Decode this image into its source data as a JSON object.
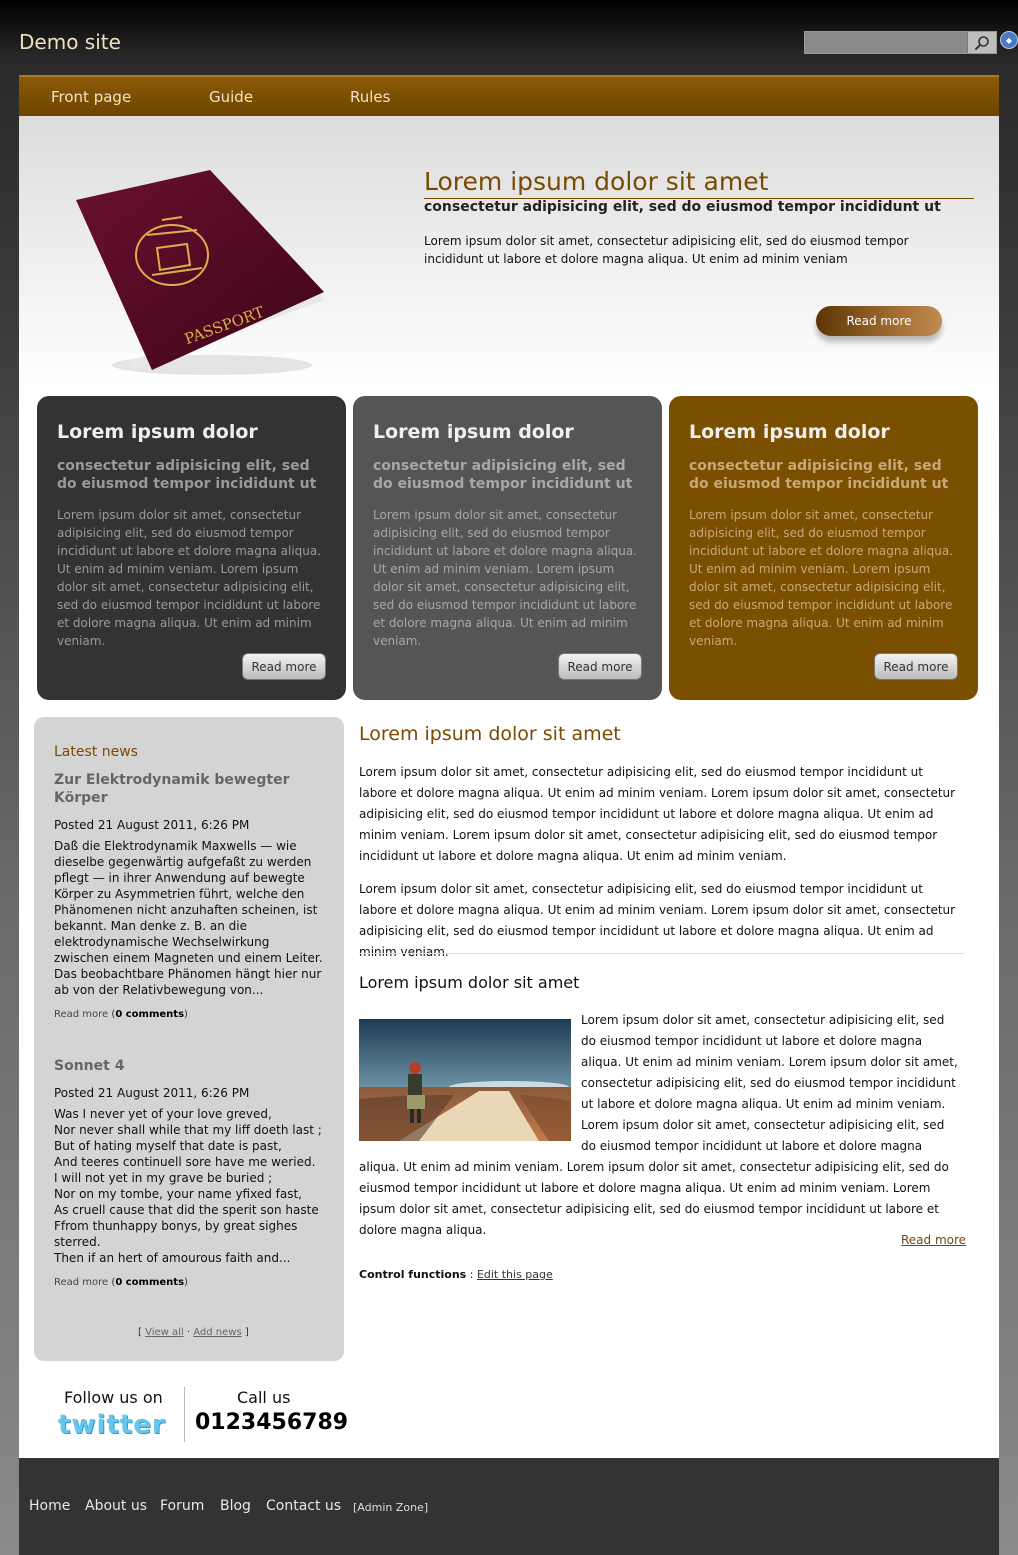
{
  "header": {
    "site_title": "Demo site",
    "search_placeholder": "",
    "search_icon": "magnifier-icon",
    "lang_icon": "language-icon"
  },
  "nav": {
    "items": [
      "Front page",
      "Guide",
      "Rules"
    ]
  },
  "hero": {
    "image": "passport-image",
    "image_text": "PASSPORT",
    "title": "Lorem ipsum dolor sit amet",
    "subtitle": "consectetur adipisicing elit, sed do eiusmod tempor incididunt ut",
    "text": "Lorem ipsum dolor sit amet, consectetur adipisicing elit, sed do eiusmod tempor incididunt ut labore et dolore magna aliqua. Ut enim ad minim veniam",
    "button": "Read more"
  },
  "features": [
    {
      "title": "Lorem ipsum dolor",
      "subtitle": "consectetur adipisicing elit, sed do eiusmod tempor incididunt ut",
      "text": "Lorem ipsum dolor sit amet, consectetur adipisicing elit, sed do eiusmod tempor incididunt ut labore et dolore magna aliqua. Ut enim ad minim veniam. Lorem ipsum dolor sit amet, consectetur adipisicing elit, sed do eiusmod tempor incididunt ut labore et dolore magna aliqua. Ut enim ad minim veniam.",
      "button": "Read more"
    },
    {
      "title": "Lorem ipsum dolor",
      "subtitle": "consectetur adipisicing elit, sed do eiusmod tempor incididunt ut",
      "text": "Lorem ipsum dolor sit amet, consectetur adipisicing elit, sed do eiusmod tempor incididunt ut labore et dolore magna aliqua. Ut enim ad minim veniam. Lorem ipsum dolor sit amet, consectetur adipisicing elit, sed do eiusmod tempor incididunt ut labore et dolore magna aliqua. Ut enim ad minim veniam.",
      "button": "Read more"
    },
    {
      "title": "Lorem ipsum dolor",
      "subtitle": "consectetur adipisicing elit, sed do eiusmod tempor incididunt ut",
      "text": "Lorem ipsum dolor sit amet, consectetur adipisicing elit, sed do eiusmod tempor incididunt ut labore et dolore magna aliqua. Ut enim ad minim veniam. Lorem ipsum dolor sit amet, consectetur adipisicing elit, sed do eiusmod tempor incididunt ut labore et dolore magna aliqua. Ut enim ad minim veniam.",
      "button": "Read more"
    }
  ],
  "news": {
    "title": "Latest news",
    "items": [
      {
        "headline": "Zur Elektrodynamik bewegter Körper",
        "posted": "Posted 21 August 2011, 6:26 PM",
        "body": "Daß die Elektrodynamik Maxwells — wie dieselbe gegenwärtig aufgefaßt zu werden pflegt — in ihrer Anwendung auf bewegte Körper zu Asymmetrien führt, welche den Phänomenen nicht anzuhaften scheinen, ist bekannt. Man denke z. B. an die elektrodynamische Wechselwirkung zwischen einem Magneten und einem Leiter. Das beobachtbare Phänomen hängt hier nur ab von der Relativbewegung von...",
        "read_more": "Read more",
        "comments": "0 comments"
      },
      {
        "headline": "Sonnet 4",
        "posted": "Posted 21 August 2011, 6:26 PM",
        "lines": [
          "Was I never yet of your love greved,",
          "Nor never shall while that my liff doeth last ;",
          "But of hating myself that date is past,",
          "And teeres continuell sore have me weried.",
          "I will not yet in my grave be buried ;",
          "Nor on my tombe, your name yfixed fast,",
          "As cruell cause that did the sperit son haste",
          "Ffrom thunhappy bonys, by great sighes",
          "sterred.",
          "Then if an hert of amourous faith and..."
        ],
        "read_more": "Read more",
        "comments": "0 comments"
      }
    ],
    "view_all": "View all",
    "add_news": "Add news"
  },
  "social": {
    "follow": "Follow us on",
    "twitter": "twitter",
    "call": "Call us",
    "phone": "0123456789"
  },
  "content": {
    "title": "Lorem ipsum dolor sit amet",
    "para1": "Lorem ipsum dolor sit amet, consectetur adipisicing elit, sed do eiusmod tempor incididunt ut labore et dolore magna aliqua. Ut enim ad minim veniam. Lorem ipsum dolor sit amet, consectetur adipisicing elit, sed do eiusmod tempor incididunt ut labore et dolore magna aliqua. Ut enim ad minim veniam. Lorem ipsum dolor sit amet, consectetur adipisicing elit, sed do eiusmod tempor incididunt ut labore et dolore magna aliqua. Ut enim ad minim veniam.",
    "para2": "Lorem ipsum dolor sit amet, consectetur adipisicing elit, sed do eiusmod tempor incididunt ut labore et dolore magna aliqua. Ut enim ad minim veniam. Lorem ipsum dolor sit amet, consectetur adipisicing elit, sed do eiusmod tempor incididunt ut labore et dolore magna aliqua. Ut enim ad minim veniam.",
    "subtitle": "Lorem ipsum dolor sit amet",
    "photo": "road-walker-photo",
    "para3": "Lorem ipsum dolor sit amet, consectetur adipisicing elit, sed do eiusmod tempor incididunt ut labore et dolore magna aliqua. Ut enim ad minim veniam. Lorem ipsum dolor sit amet, consectetur adipisicing elit, sed do eiusmod tempor incididunt ut labore et dolore magna aliqua. Ut enim ad minim veniam. Lorem ipsum dolor sit amet, consectetur adipisicing elit, sed do eiusmod tempor incididunt ut labore et dolore magna aliqua. Ut enim ad minim veniam. Lorem ipsum dolor sit amet, consectetur adipisicing elit, sed do eiusmod tempor incididunt ut labore et dolore magna aliqua. Ut enim ad minim veniam. Lorem ipsum dolor sit amet, consectetur adipisicing elit, sed do eiusmod tempor incididunt ut labore et dolore magna aliqua.",
    "read_more": "Read more",
    "control_label": "Control functions",
    "edit_link": "Edit this page"
  },
  "footer": {
    "links": [
      "Home",
      "About us",
      "Forum",
      "Blog",
      "Contact us"
    ],
    "admin": "[Admin Zone]"
  },
  "colors": {
    "accent": "#7a4a00",
    "nav": "#6e4400",
    "footer": "#333333"
  }
}
